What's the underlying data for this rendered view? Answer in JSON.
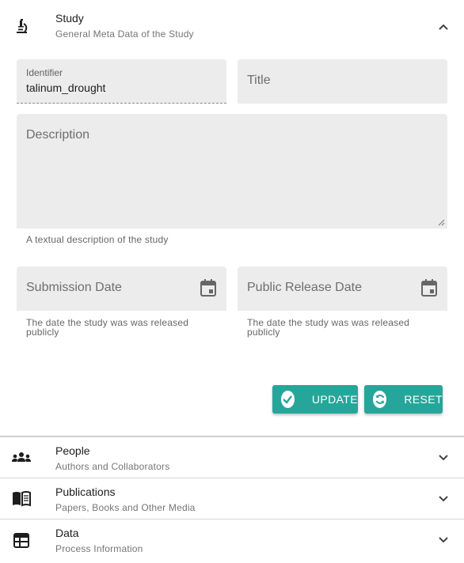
{
  "study": {
    "title": "Study",
    "subtitle": "General Meta Data of the Study",
    "icon": "microscope-icon",
    "expanded": true,
    "identifier": {
      "label": "Identifier",
      "value": "talinum_drought"
    },
    "title_field": {
      "placeholder": "Title"
    },
    "description": {
      "placeholder": "Description",
      "hint": "A textual description of the study"
    },
    "submission_date": {
      "placeholder": "Submission Date",
      "hint": "The date the study was was released publicly"
    },
    "public_release_date": {
      "placeholder": "Public Release Date",
      "hint": "The date the study was was released publicly"
    },
    "update_label": "UPDATE",
    "reset_label": "RESET"
  },
  "sections": [
    {
      "title": "People",
      "subtitle": "Authors and Collaborators",
      "icon": "people-icon"
    },
    {
      "title": "Publications",
      "subtitle": "Papers, Books and Other Media",
      "icon": "book-icon"
    },
    {
      "title": "Data",
      "subtitle": "Process Information",
      "icon": "table-icon"
    }
  ],
  "colors": {
    "accent": "#26a69a",
    "field_bg": "#ececec"
  }
}
